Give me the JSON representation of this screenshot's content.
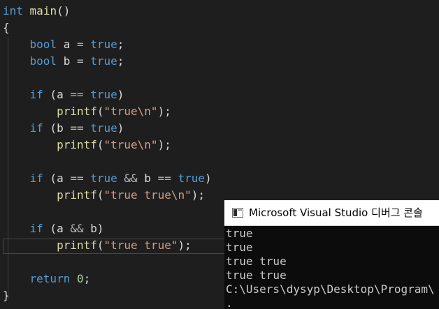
{
  "editor": {
    "lines": [
      [
        {
          "t": "int",
          "c": "kw"
        },
        {
          "t": " ",
          "c": "pl"
        },
        {
          "t": "main",
          "c": "fn"
        },
        {
          "t": "()",
          "c": "pl"
        }
      ],
      [
        {
          "t": "{",
          "c": "pl"
        }
      ],
      [
        {
          "t": "    ",
          "c": "pl"
        },
        {
          "t": "bool",
          "c": "kw"
        },
        {
          "t": " a ",
          "c": "pl"
        },
        {
          "t": "=",
          "c": "op"
        },
        {
          "t": " ",
          "c": "pl"
        },
        {
          "t": "true",
          "c": "kw"
        },
        {
          "t": ";",
          "c": "pl"
        }
      ],
      [
        {
          "t": "    ",
          "c": "pl"
        },
        {
          "t": "bool",
          "c": "kw"
        },
        {
          "t": " b ",
          "c": "pl"
        },
        {
          "t": "=",
          "c": "op"
        },
        {
          "t": " ",
          "c": "pl"
        },
        {
          "t": "true",
          "c": "kw"
        },
        {
          "t": ";",
          "c": "pl"
        }
      ],
      [],
      [
        {
          "t": "    ",
          "c": "pl"
        },
        {
          "t": "if",
          "c": "kw"
        },
        {
          "t": " (a ",
          "c": "pl"
        },
        {
          "t": "==",
          "c": "op"
        },
        {
          "t": " ",
          "c": "pl"
        },
        {
          "t": "true",
          "c": "kw"
        },
        {
          "t": ")",
          "c": "pl"
        }
      ],
      [
        {
          "t": "        ",
          "c": "pl"
        },
        {
          "t": "printf",
          "c": "fn"
        },
        {
          "t": "(",
          "c": "pl"
        },
        {
          "t": "\"true\\n\"",
          "c": "str"
        },
        {
          "t": ");",
          "c": "pl"
        }
      ],
      [
        {
          "t": "    ",
          "c": "pl"
        },
        {
          "t": "if",
          "c": "kw"
        },
        {
          "t": " (b ",
          "c": "pl"
        },
        {
          "t": "==",
          "c": "op"
        },
        {
          "t": " ",
          "c": "pl"
        },
        {
          "t": "true",
          "c": "kw"
        },
        {
          "t": ")",
          "c": "pl"
        }
      ],
      [
        {
          "t": "        ",
          "c": "pl"
        },
        {
          "t": "printf",
          "c": "fn"
        },
        {
          "t": "(",
          "c": "pl"
        },
        {
          "t": "\"true\\n\"",
          "c": "str"
        },
        {
          "t": ");",
          "c": "pl"
        }
      ],
      [],
      [
        {
          "t": "    ",
          "c": "pl"
        },
        {
          "t": "if",
          "c": "kw"
        },
        {
          "t": " (a ",
          "c": "pl"
        },
        {
          "t": "==",
          "c": "op"
        },
        {
          "t": " ",
          "c": "pl"
        },
        {
          "t": "true",
          "c": "kw"
        },
        {
          "t": " ",
          "c": "pl"
        },
        {
          "t": "&&",
          "c": "op"
        },
        {
          "t": " b ",
          "c": "pl"
        },
        {
          "t": "==",
          "c": "op"
        },
        {
          "t": " ",
          "c": "pl"
        },
        {
          "t": "true",
          "c": "kw"
        },
        {
          "t": ")",
          "c": "pl"
        }
      ],
      [
        {
          "t": "        ",
          "c": "pl"
        },
        {
          "t": "printf",
          "c": "fn"
        },
        {
          "t": "(",
          "c": "pl"
        },
        {
          "t": "\"true true\\n\"",
          "c": "str"
        },
        {
          "t": ");",
          "c": "pl"
        }
      ],
      [],
      [
        {
          "t": "    ",
          "c": "pl"
        },
        {
          "t": "if",
          "c": "kw"
        },
        {
          "t": " (a ",
          "c": "pl"
        },
        {
          "t": "&&",
          "c": "op"
        },
        {
          "t": " b)",
          "c": "pl"
        }
      ],
      [
        {
          "t": "        ",
          "c": "pl"
        },
        {
          "t": "printf",
          "c": "fn"
        },
        {
          "t": "(",
          "c": "pl"
        },
        {
          "t": "\"true true\"",
          "c": "str"
        },
        {
          "t": ");",
          "c": "pl"
        }
      ],
      [],
      [
        {
          "t": "    ",
          "c": "pl"
        },
        {
          "t": "return",
          "c": "kw"
        },
        {
          "t": " ",
          "c": "pl"
        },
        {
          "t": "0",
          "c": "num"
        },
        {
          "t": ";",
          "c": "pl"
        }
      ],
      [
        {
          "t": "}",
          "c": "pl"
        }
      ]
    ]
  },
  "console": {
    "icon": "console-window-icon",
    "title": "Microsoft Visual Studio 디버그 콘솔",
    "output": [
      "true",
      "true",
      "true true",
      "true true",
      "C:\\Users\\dysyp\\Desktop\\Program\\",
      "."
    ]
  },
  "colors": {
    "editor_bg": "#1e1e1e",
    "keyword": "#569cd6",
    "function": "#dcdcaa",
    "string": "#d69d85",
    "number": "#b5cea8",
    "console_bg": "#0c0c0c",
    "console_text": "#cccccc"
  }
}
